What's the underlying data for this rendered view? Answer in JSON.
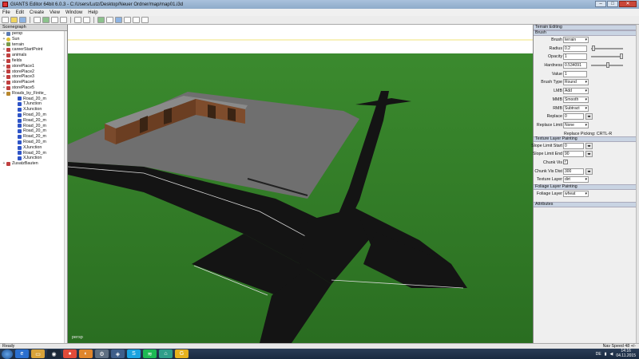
{
  "window": {
    "title": "GIANTS Editor 64bit 6.0.3 - C:/Users/Lutz/Desktop/Neuer Ordner/map/map01.i3d"
  },
  "menu": [
    "File",
    "Edit",
    "Create",
    "View",
    "Window",
    "Help"
  ],
  "scenegraph": {
    "header": "Scenegraph",
    "items": [
      {
        "label": "persp",
        "icon": "camera-icon",
        "indent": 1
      },
      {
        "label": "Sun",
        "icon": "light-icon",
        "indent": 1
      },
      {
        "label": "terrain",
        "icon": "terrain-icon",
        "indent": 1
      },
      {
        "label": "careerStartPoint",
        "icon": "node-icon",
        "indent": 1
      },
      {
        "label": "animals",
        "icon": "node-icon",
        "indent": 1
      },
      {
        "label": "fields",
        "icon": "node-icon",
        "indent": 1
      },
      {
        "label": "storePlace1",
        "icon": "node-icon",
        "indent": 1
      },
      {
        "label": "storePlace2",
        "icon": "node-icon",
        "indent": 1
      },
      {
        "label": "storePlace3",
        "icon": "node-icon",
        "indent": 1
      },
      {
        "label": "storePlace4",
        "icon": "node-icon",
        "indent": 1
      },
      {
        "label": "storePlace5",
        "icon": "node-icon",
        "indent": 1
      },
      {
        "label": "Roads_by_Finite_",
        "icon": "group-icon",
        "indent": 1
      },
      {
        "label": "Road_20_m",
        "icon": "mesh-icon",
        "indent": 2
      },
      {
        "label": "TJunction",
        "icon": "mesh-icon",
        "indent": 2
      },
      {
        "label": "XJunction",
        "icon": "mesh-icon",
        "indent": 2
      },
      {
        "label": "Road_20_m",
        "icon": "mesh-icon",
        "indent": 2
      },
      {
        "label": "Road_20_m",
        "icon": "mesh-icon",
        "indent": 2
      },
      {
        "label": "Road_20_m",
        "icon": "mesh-icon",
        "indent": 2
      },
      {
        "label": "Road_20_m",
        "icon": "mesh-icon",
        "indent": 2
      },
      {
        "label": "Road_20_m",
        "icon": "mesh-icon",
        "indent": 2
      },
      {
        "label": "Road_20_m",
        "icon": "mesh-icon",
        "indent": 2
      },
      {
        "label": "XJunction",
        "icon": "mesh-icon",
        "indent": 2
      },
      {
        "label": "Road_20_m",
        "icon": "mesh-icon",
        "indent": 2
      },
      {
        "label": "XJunction",
        "icon": "mesh-icon",
        "indent": 2
      },
      {
        "label": "ZusatzBauten",
        "icon": "node-icon",
        "indent": 1
      }
    ]
  },
  "viewport": {
    "camera_label": "persp"
  },
  "terrain_editing": {
    "header": "Terrain Editing",
    "brush_section": "Brush",
    "brush": {
      "label": "Brush",
      "value": "terrain"
    },
    "radius": {
      "label": "Radius",
      "value": "0.2",
      "slider": 0.02
    },
    "opacity": {
      "label": "Opacity",
      "value": "1",
      "slider": 1.0
    },
    "hardness": {
      "label": "Hardness",
      "value": "0.534091",
      "slider": 0.53
    },
    "value": {
      "label": "Value",
      "value": "1"
    },
    "brush_type": {
      "label": "Brush Type",
      "value": "Round"
    },
    "lmb": {
      "label": "LMB",
      "value": "Add"
    },
    "mmb": {
      "label": "MMB",
      "value": "Smooth"
    },
    "rmb": {
      "label": "RMB",
      "value": "Subtract"
    },
    "replace": {
      "label": "Replace",
      "value": "0"
    },
    "replace_limit": {
      "label": "Replace Limit",
      "value": "None"
    },
    "replace_picking": "Replace Picking: CRTL-R"
  },
  "texture_layer": {
    "header": "Texture Layer Painting",
    "slope_start": {
      "label": "Slope Limit Start",
      "value": "0"
    },
    "slope_end": {
      "label": "Slope Limit End",
      "value": "90"
    },
    "chunk_vis": {
      "label": "Chunk Vis",
      "checked": true
    },
    "chunk_vis_dist": {
      "label": "Chunk Vis Dist",
      "value": "300"
    },
    "texture_layer": {
      "label": "Texture Layer",
      "value": "dirt"
    }
  },
  "foliage_layer": {
    "header": "Foliage Layer Painting",
    "layer": {
      "label": "Foliage Layer",
      "value": "wheat"
    }
  },
  "attributes": {
    "header": "Attributes"
  },
  "status": {
    "left": "Ready",
    "right": "Nav Speed 48 +/-"
  },
  "taskbar": {
    "apps": [
      "ie-icon",
      "explorer-icon",
      "steam-icon",
      "chrome-icon",
      "firefox-icon",
      "settings-icon",
      "editor-icon",
      "skype-icon",
      "spotify-icon",
      "store-icon",
      "giants-icon"
    ],
    "language": "DE",
    "time": "14:16",
    "date": "04.11.2015"
  },
  "colors": {
    "grass": "#2f7a26",
    "road": "#141414",
    "concrete": "#6e6e6e",
    "sky": "#ffffff",
    "brick": "#7a4a2c"
  }
}
